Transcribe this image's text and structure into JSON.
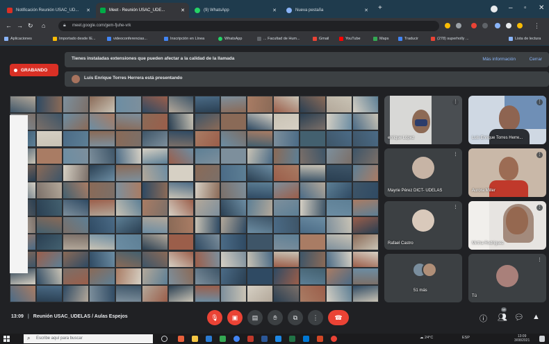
{
  "browser": {
    "tabs": [
      {
        "title": "Notificación Reunión USAC_UD...",
        "favicon_color": "#d93025",
        "active": false
      },
      {
        "title": "Meet - Reunión USAC_UDE...",
        "favicon_color": "#00ac47",
        "active": true
      },
      {
        "title": "(9) WhatsApp",
        "favicon_color": "#25d366",
        "active": false
      },
      {
        "title": "Nueva pestaña",
        "favicon_color": "#8ab4f8",
        "active": false
      }
    ],
    "new_tab_label": "+",
    "url": "meet.google.com/gem-fjuhe-vrk",
    "bookmarks": [
      {
        "label": "Aplicaciones",
        "color": "#8ab4f8"
      },
      {
        "label": "Importado desde IE...",
        "color": "#fbbc04"
      },
      {
        "label": "videoconferencias...",
        "color": "#4285f4"
      },
      {
        "label": "Inscripción en Línea",
        "color": "#4285f4"
      },
      {
        "label": "WhatsApp",
        "color": "#25d366"
      },
      {
        "label": "... Facultad de Hum...",
        "color": "#5f6368"
      },
      {
        "label": "Gmail",
        "color": "#ea4335"
      },
      {
        "label": "YouTube",
        "color": "#ff0000"
      },
      {
        "label": "Maps",
        "color": "#34a853"
      },
      {
        "label": "Traducir",
        "color": "#4285f4"
      },
      {
        "label": "(278) superholly ...",
        "color": "#ea4335"
      },
      {
        "label": "Lista de lectura",
        "color": "#8ab4f8"
      }
    ]
  },
  "meet": {
    "recording_label": "GRABANDO",
    "banner": {
      "text": "Tienes instaladas extensiones que pueden afectar a la calidad de la llamada",
      "more_label": "Más información",
      "close_label": "Cerrar"
    },
    "presenting_text": "Luis Enrique Torres Herrera está presentando",
    "participants": [
      {
        "name": "enrique López",
        "type": "video"
      },
      {
        "name": "Luis Enrique Torres Herre...",
        "type": "video"
      },
      {
        "name": "Mayrie Pérez DICT- UDELAS",
        "type": "avatar"
      },
      {
        "name": "Aurora Miller",
        "type": "video"
      },
      {
        "name": "Rafael Castro",
        "type": "avatar"
      },
      {
        "name": "Mirtha Rodríguez",
        "type": "video"
      },
      {
        "name": "51 más",
        "type": "more"
      },
      {
        "name": "Tú",
        "type": "avatar"
      }
    ],
    "time": "13:09",
    "meeting_title": "Reunión USAC_UDELAS / Aulas Espejos",
    "participants_badge": "59"
  },
  "taskbar": {
    "search_placeholder": "Escribe aquí para buscar",
    "weather": "24°C",
    "lang": "ESP",
    "time": "13:09",
    "date": "3/08/2021"
  },
  "colors": {
    "meet_bg": "#202124",
    "record_red": "#d93025",
    "link_blue": "#8ab4f8",
    "hangup_red": "#ea4335"
  }
}
